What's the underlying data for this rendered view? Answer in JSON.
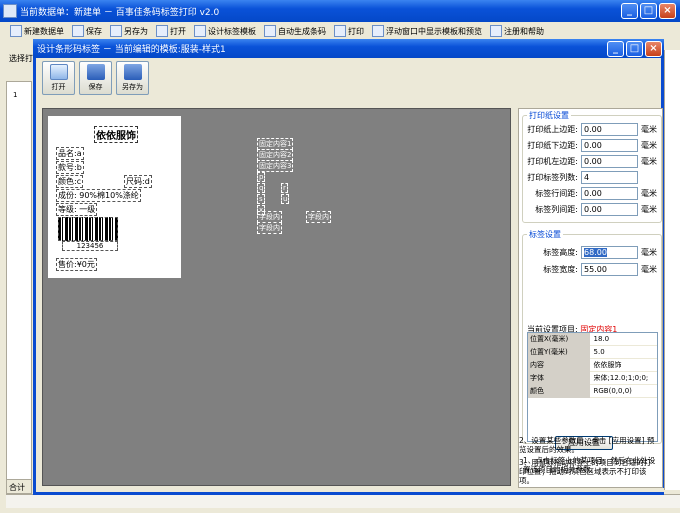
{
  "main_window": {
    "title": "当前数据单：新建单 － 百事佳条码标签打印 v2.0",
    "toolbar": [
      {
        "label": "新建数据单",
        "icon": "new-document-icon"
      },
      {
        "label": "保存",
        "icon": "save-icon"
      },
      {
        "label": "另存为",
        "icon": "save-as-icon"
      },
      {
        "label": "打开",
        "icon": "folder-open-icon"
      },
      {
        "label": "设计标签模板",
        "icon": "barcode-design-icon"
      },
      {
        "label": "自动生成条码",
        "icon": "barcode-generate-icon"
      },
      {
        "label": "打印",
        "icon": "printer-icon"
      },
      {
        "label": "浮动窗口中显示模板和预览",
        "icon": "float-window-icon"
      },
      {
        "label": "注册和帮助",
        "icon": "help-icon"
      }
    ],
    "sidebar_label": "选择打",
    "row_number": "1",
    "footer_total": "合计"
  },
  "dialog": {
    "title": "设计条形码标签 － 当前编辑的模板:服装-样式1",
    "tools": [
      {
        "label": "打开",
        "icon": "open-icon"
      },
      {
        "label": "保存",
        "icon": "save-icon"
      },
      {
        "label": "另存为",
        "icon": "save-as-icon"
      }
    ],
    "label_preview": {
      "title": "依依服饰",
      "fields": [
        "品名:a",
        "款号:b",
        "颜色:c",
        "尺码:d",
        "成份: 90%棉10%涤纶",
        "等级: 一级"
      ],
      "barcode_number": "123456",
      "price": "售价:¥0元"
    },
    "ghost_fields": [
      "固定内容1",
      "固定内容2",
      "固定内容3",
      "p",
      "q",
      "r",
      "s",
      "u",
      "x",
      "字段内",
      "字段内",
      "字段内"
    ],
    "print_paper": {
      "title": "打印纸设置",
      "rows": [
        {
          "label": "打印纸上边距:",
          "value": "0.00",
          "unit": "毫米"
        },
        {
          "label": "打印纸下边距:",
          "value": "0.00",
          "unit": "毫米"
        },
        {
          "label": "打印机左边距:",
          "value": "0.00",
          "unit": "毫米"
        },
        {
          "label": "打印标签列数:",
          "value": "4",
          "unit": ""
        },
        {
          "label": "标签行间距:",
          "value": "0.00",
          "unit": "毫米"
        },
        {
          "label": "标签列间距:",
          "value": "0.00",
          "unit": "毫米"
        }
      ]
    },
    "label_settings": {
      "title": "标签设置",
      "height_label": "标签高度:",
      "height_value": "68.00",
      "height_unit": "毫米",
      "width_label": "标签宽度:",
      "width_value": "55.00",
      "width_unit": "毫米",
      "current_item_label": "当前设置项目:",
      "current_item_value": "固定内容1",
      "properties": [
        {
          "key": "位置X(毫米)",
          "value": "18.0"
        },
        {
          "key": "位置Y(毫米)",
          "value": "5.0"
        },
        {
          "key": "内容",
          "value": "依依服饰"
        },
        {
          "key": "字体",
          "value": "宋体;12.0;1;0;0;"
        },
        {
          "key": "颜色",
          "value": "RGB(0,0,0)"
        }
      ],
      "apply_button": "应用设置"
    },
    "notes": [
      "1、点击标签上的某项目，然后在此处设置该项目的相关参数。",
      "2、设置某些参数后，点击 [应用设置] 预览设置后的效果。",
      "3、用鼠标拖动标签上的项目到合适的打印位置；拖动到灰色区域表示不打印该项。"
    ]
  }
}
